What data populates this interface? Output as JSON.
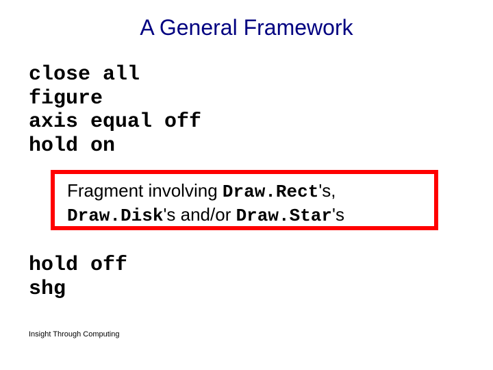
{
  "title": "A General Framework",
  "code_top": "close all\nfigure\naxis equal off\nhold on",
  "fragment": {
    "pre1": "Fragment involving ",
    "d1": "Draw.Rect",
    "post1": "'s,",
    "d2": "Draw.Disk",
    "mid2": "'s ",
    "andor": "and/or ",
    "d3": "Draw.Star",
    "post3": "'s"
  },
  "code_bottom": "hold off\nshg",
  "footer": "Insight Through Computing"
}
